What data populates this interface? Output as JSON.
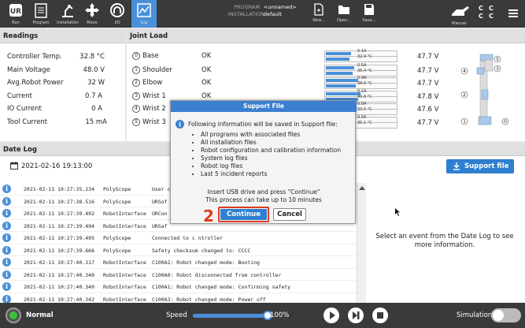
{
  "topbar": {
    "nav": [
      {
        "label": "Run",
        "icon": "ur-logo-icon"
      },
      {
        "label": "Program",
        "icon": "program-icon"
      },
      {
        "label": "Installation",
        "icon": "installation-icon"
      },
      {
        "label": "Move",
        "icon": "move-icon"
      },
      {
        "label": "I/O",
        "icon": "io-icon"
      },
      {
        "label": "Log",
        "icon": "log-icon"
      }
    ],
    "program_label": "PROGRAM",
    "program_value": "<unnamed>",
    "installation_label": "INSTALLATION",
    "installation_value": "default",
    "file_buttons": [
      {
        "label": "New...",
        "icon": "new-file-icon"
      },
      {
        "label": "Open...",
        "icon": "open-folder-icon"
      },
      {
        "label": "Save...",
        "icon": "save-icon"
      }
    ],
    "mode_label": "Manual",
    "ccc": [
      "C",
      "C",
      "C",
      "C"
    ]
  },
  "readings": {
    "title": "Readings",
    "items": [
      {
        "label": "Controller Temp.",
        "value": "32.8 °C"
      },
      {
        "label": "Main Voltage",
        "value": "48.0 V"
      },
      {
        "label": "Avg.Robot Power",
        "value": "32 W"
      },
      {
        "label": "Current",
        "value": "0.7 A"
      },
      {
        "label": "IO Current",
        "value": "0 A"
      },
      {
        "label": "Tool Current",
        "value": "15 mA"
      }
    ]
  },
  "joint_load": {
    "title": "Joint Load",
    "joints": [
      {
        "num": "0",
        "name": "Base",
        "status": "OK",
        "current": "0.1A",
        "temp": "32.9 °C",
        "level": 0.35,
        "voltage": "47.7 V"
      },
      {
        "num": "1",
        "name": "Shoulder",
        "status": "OK",
        "current": "0.5A",
        "temp": "35.4 °C",
        "level": 0.4,
        "voltage": "47.7 V"
      },
      {
        "num": "2",
        "name": "Elbow",
        "status": "OK",
        "current": "0.9A",
        "temp": "38.6 °C",
        "level": 0.45,
        "voltage": "47.7 V"
      },
      {
        "num": "3",
        "name": "Wrist 1",
        "status": "OK",
        "current": "0.1A",
        "temp": "40.6 °C",
        "level": 0.48,
        "voltage": "47.8 V"
      },
      {
        "num": "4",
        "name": "Wrist 2",
        "status": "OK",
        "current": "0.0A",
        "temp": "33.5 °C",
        "level": 0.36,
        "voltage": "47.6 V"
      },
      {
        "num": "5",
        "name": "Wrist 3",
        "status": "OK",
        "current": "0.0A",
        "temp": "35.1 °C",
        "level": 0.38,
        "voltage": "47.7 V"
      }
    ],
    "diagram_labels": [
      "5",
      "4",
      "3",
      "2",
      "1",
      "0"
    ]
  },
  "date_log": {
    "title": "Date Log",
    "date": "2021-02-16 19:13:00",
    "support_file_button": "Support file",
    "rows": [
      {
        "time": "2021-02-11 10:27:35.234",
        "source": "PolyScope",
        "message": "User c"
      },
      {
        "time": "2021-02-11 10:27:38.516",
        "source": "PolyScope",
        "message": "URSof"
      },
      {
        "time": "2021-02-11 10:27:39.492",
        "source": "RobotInterface",
        "message": "URCon"
      },
      {
        "time": "2021-02-11 10:27:39.494",
        "source": "RobotInterface",
        "message": "URSaf"
      },
      {
        "time": "2021-02-11 10:27:39.495",
        "source": "PolyScope",
        "message": "Connected to c  ntroller"
      },
      {
        "time": "2021-02-11 10:27:39.666",
        "source": "PolyScope",
        "message": "Safety checksum changed to: CCCC"
      },
      {
        "time": "2021-02-11 10:27:40.317",
        "source": "RobotInterface",
        "message": "C100A2: Robot changed mode: Booting"
      },
      {
        "time": "2021-02-11 10:27:40.340",
        "source": "RobotInterface",
        "message": "C100A0: Robot disconnected from controller"
      },
      {
        "time": "2021-02-11 10:27:40.340",
        "source": "RobotInterface",
        "message": "C100A1: Robot changed mode: Confirming safety"
      },
      {
        "time": "2021-02-11 10:27:40.342",
        "source": "RobotInterface",
        "message": "C100A3: Robot changed mode: Power off"
      }
    ],
    "detail_placeholder": "Select an event from the Date Log to see more information."
  },
  "dialog": {
    "title": "Support File",
    "intro": "Following information will be saved in Support file:",
    "items": [
      "All programs with associated files",
      "All installation files",
      "Robot configuration and calibration information",
      "System log files",
      "Robot log files",
      "Last 5 incident reports"
    ],
    "instruction_line1": "Insert USB drive and press \"Continue\"",
    "instruction_line2": "This process can take up to 10 minutes",
    "continue_label": "Continue",
    "cancel_label": "Cancel",
    "step_marker": "2"
  },
  "bottombar": {
    "status": "Normal",
    "speed_label": "Speed",
    "speed_value": "100%",
    "speed_level": 1.0,
    "simulation_label": "Simulation"
  },
  "colors": {
    "accent": "#4a90d9",
    "dialog_title": "#3b7fd0",
    "marker_red": "#e03a1e",
    "status_green": "#39c43a"
  }
}
